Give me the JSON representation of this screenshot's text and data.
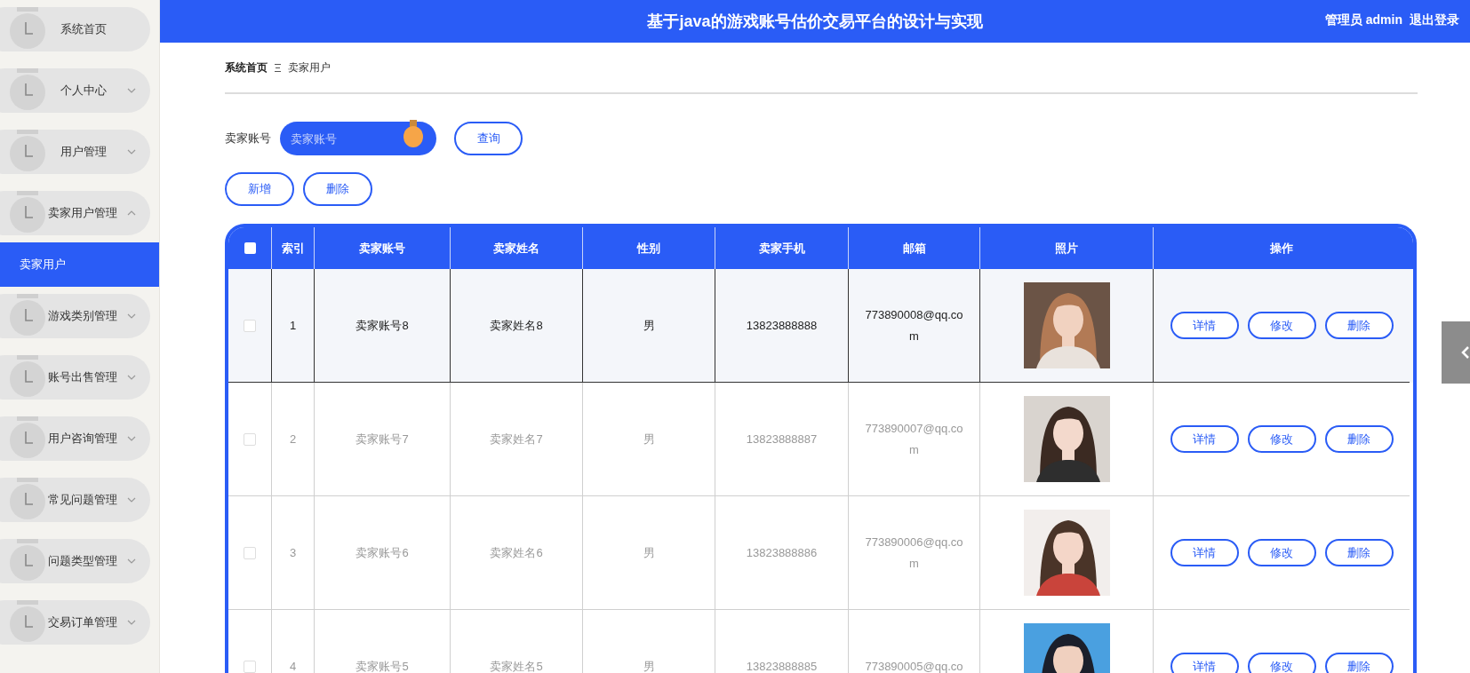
{
  "header": {
    "title": "基于java的游戏账号估价交易平台的设计与实现",
    "user_label": "管理员 admin",
    "logout": "退出登录"
  },
  "sidebar": {
    "items": [
      {
        "label": "系统首页",
        "kind": "link"
      },
      {
        "label": "个人中心",
        "kind": "menu",
        "expanded": false
      },
      {
        "label": "用户管理",
        "kind": "menu",
        "expanded": false
      },
      {
        "label": "卖家用户管理",
        "kind": "menu",
        "expanded": true,
        "children": [
          {
            "label": "卖家用户",
            "selected": true
          }
        ]
      },
      {
        "label": "游戏类别管理",
        "kind": "menu",
        "expanded": false
      },
      {
        "label": "账号出售管理",
        "kind": "menu",
        "expanded": false
      },
      {
        "label": "用户咨询管理",
        "kind": "menu",
        "expanded": false
      },
      {
        "label": "常见问题管理",
        "kind": "menu",
        "expanded": false
      },
      {
        "label": "问题类型管理",
        "kind": "menu",
        "expanded": false
      },
      {
        "label": "交易订单管理",
        "kind": "menu",
        "expanded": false
      }
    ]
  },
  "breadcrumb": [
    "系统首页",
    "卖家用户"
  ],
  "search": {
    "label": "卖家账号",
    "placeholder": "卖家账号",
    "button": "查询"
  },
  "actions": [
    "新增",
    "删除"
  ],
  "table": {
    "columns": [
      "索引",
      "卖家账号",
      "卖家姓名",
      "性别",
      "卖家手机",
      "邮箱",
      "照片",
      "操作"
    ],
    "select_all": {
      "checked": false
    },
    "rows": [
      {
        "index": "1",
        "account": "卖家账号8",
        "name": "卖家姓名8",
        "gender": "男",
        "phone": "13823888888",
        "email": "773890008@qq.com",
        "highlighted": true,
        "checked": false,
        "photo": {
          "kind": "picture"
        },
        "buttons": [
          "详情",
          "修改",
          "删除"
        ]
      },
      {
        "index": "2",
        "account": "卖家账号7",
        "name": "卖家姓名7",
        "gender": "男",
        "phone": "13823888887",
        "email": "773890007@qq.com",
        "highlighted": false,
        "checked": false,
        "photo": {
          "kind": "picture"
        },
        "buttons": [
          "详情",
          "修改",
          "删除"
        ]
      },
      {
        "index": "3",
        "account": "卖家账号6",
        "name": "卖家姓名6",
        "gender": "男",
        "phone": "13823888886",
        "email": "773890006@qq.com",
        "highlighted": false,
        "checked": false,
        "photo": {
          "kind": "picture"
        },
        "buttons": [
          "详情",
          "修改",
          "删除"
        ]
      },
      {
        "index": "4",
        "account": "卖家账号5",
        "name": "卖家姓名5",
        "gender": "男",
        "phone": "13823888885",
        "email": "773890005@qq.co",
        "highlighted": false,
        "checked": false,
        "photo": {
          "kind": "picture"
        },
        "buttons": [
          "详情",
          "修改",
          "删除"
        ]
      }
    ]
  }
}
